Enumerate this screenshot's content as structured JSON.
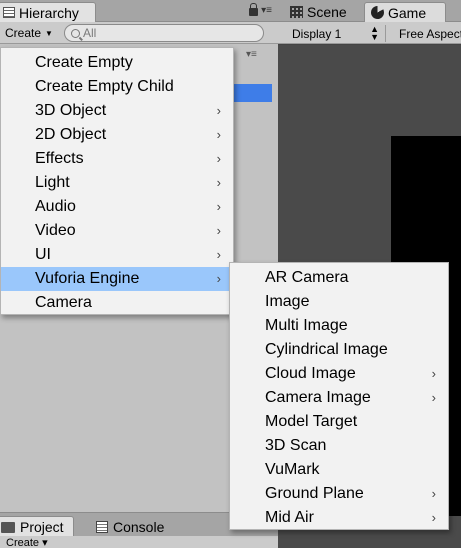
{
  "hierarchy": {
    "tab_label": "Hierarchy",
    "create_label": "Create",
    "search_placeholder": "All"
  },
  "scene_game": {
    "scene_tab": "Scene",
    "game_tab": "Game",
    "display_label": "Display 1",
    "aspect_label": "Free Aspect"
  },
  "bottom": {
    "project_tab": "Project",
    "console_tab": "Console",
    "create_label": "Create"
  },
  "context_menu": {
    "items": [
      {
        "label": "Create Empty",
        "has_submenu": false
      },
      {
        "label": "Create Empty Child",
        "has_submenu": false
      },
      {
        "label": "3D Object",
        "has_submenu": true
      },
      {
        "label": "2D Object",
        "has_submenu": true
      },
      {
        "label": "Effects",
        "has_submenu": true
      },
      {
        "label": "Light",
        "has_submenu": true
      },
      {
        "label": "Audio",
        "has_submenu": true
      },
      {
        "label": "Video",
        "has_submenu": true
      },
      {
        "label": "UI",
        "has_submenu": true
      },
      {
        "label": "Vuforia Engine",
        "has_submenu": true,
        "highlighted": true
      },
      {
        "label": "Camera",
        "has_submenu": false
      }
    ]
  },
  "vuforia_submenu": {
    "items": [
      {
        "label": "AR Camera",
        "has_submenu": false
      },
      {
        "label": "Image",
        "has_submenu": false
      },
      {
        "label": "Multi Image",
        "has_submenu": false
      },
      {
        "label": "Cylindrical Image",
        "has_submenu": false
      },
      {
        "label": "Cloud Image",
        "has_submenu": true
      },
      {
        "label": "Camera Image",
        "has_submenu": true
      },
      {
        "label": "Model Target",
        "has_submenu": false
      },
      {
        "label": "3D Scan",
        "has_submenu": false
      },
      {
        "label": "VuMark",
        "has_submenu": false
      },
      {
        "label": "Ground Plane",
        "has_submenu": true
      },
      {
        "label": "Mid Air",
        "has_submenu": true
      }
    ]
  },
  "colors": {
    "highlight": "#9ac7fb",
    "selection": "#3e7de8",
    "menu_bg": "#f2f2f2"
  },
  "icons": {
    "submenu_arrow": "chevron-right-icon"
  }
}
